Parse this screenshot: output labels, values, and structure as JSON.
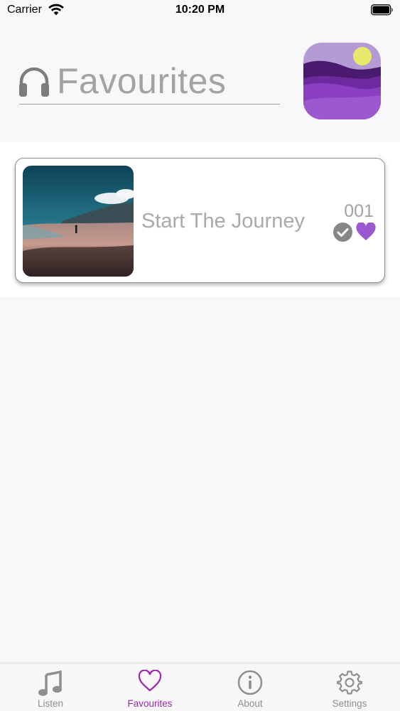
{
  "status_bar": {
    "carrier": "Carrier",
    "time": "10:20 PM"
  },
  "header": {
    "title": "Favourites",
    "icon": "headphones-icon"
  },
  "favourites": [
    {
      "title": "Start The Journey",
      "number": "001",
      "completed": true,
      "favourite": true
    }
  ],
  "tab_bar": {
    "tabs": [
      {
        "label": "Listen",
        "icon": "music-note-icon",
        "active": false
      },
      {
        "label": "Favourites",
        "icon": "heart-outline-icon",
        "active": true
      },
      {
        "label": "About",
        "icon": "info-icon",
        "active": false
      },
      {
        "label": "Settings",
        "icon": "gear-icon",
        "active": false
      }
    ]
  },
  "colors": {
    "accent": "#9b27b0",
    "heart": "#9b59d0",
    "muted_text": "#a3a3a6",
    "inactive_tab": "#8e8e93"
  }
}
